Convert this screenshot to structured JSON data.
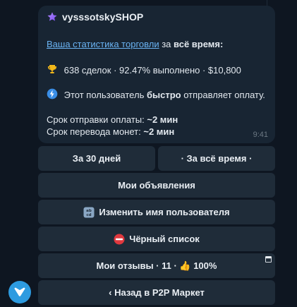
{
  "message": {
    "sender": "vysssotskySHOP",
    "stats_link": "Ваша статистика торговли",
    "stats_for": "за",
    "stats_period": "всё время:",
    "deals_line": "638 сделок · 92.47% выполнено · $10,800",
    "fast_prefix": "Этот пользователь",
    "fast_bold": "быстро",
    "fast_suffix": "отправляет оплату.",
    "pay_time_label": "Срок отправки оплаты:",
    "pay_time_value": "~2 мин",
    "transfer_time_label": "Срок перевода монет:",
    "transfer_time_value": "~2 мин",
    "time": "9:41"
  },
  "buttons": {
    "period_30": "За 30 дней",
    "period_all": "· За всё время ·",
    "my_ads": "Мои объявления",
    "change_name": "Изменить имя пользователя",
    "blacklist": "Чёрный список",
    "my_reviews": "Мои отзывы · 11 · 👍 100%",
    "back_p2p": "‹ Назад в P2P Маркет"
  },
  "colors": {
    "background": "#0e1621",
    "bubble": "#182533",
    "button": "#1f2c39",
    "link": "#6ab3f3",
    "avatar": "#2d9be0"
  }
}
